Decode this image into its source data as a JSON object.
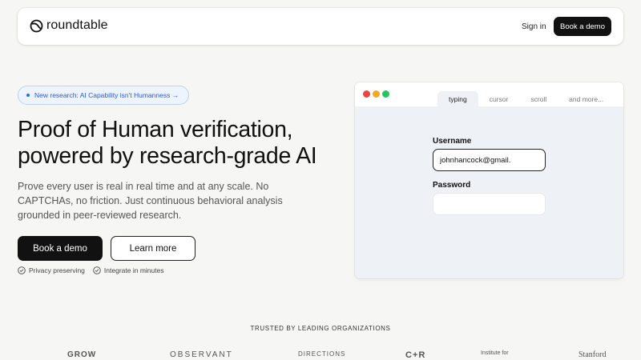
{
  "header": {
    "brand": "roundtable",
    "sign_in": "Sign in",
    "book_demo": "Book a demo"
  },
  "hero": {
    "pill": "New research: AI Capability isn't Humanness →",
    "title_line1": "Proof of Human verification,",
    "title_line2": "powered by research-grade AI",
    "subtitle": "Prove every user is real in real time and at any scale. No CAPTCHAs, no friction. Just continuous behavioral analysis grounded in peer-reviewed research.",
    "primary_button": "Book a demo",
    "secondary_button": "Learn more",
    "checks": [
      "Privacy preserving",
      "Integrate in minutes"
    ]
  },
  "demo": {
    "tabs": [
      "typing",
      "cursor",
      "scroll",
      "and more..."
    ],
    "active_tab": "typing",
    "username_label": "Username",
    "username_value": "johnhancock@gmail.",
    "password_label": "Password",
    "password_value": ""
  },
  "trusted": {
    "heading": "TRUSTED BY LEADING ORGANIZATIONS",
    "logos": [
      "GROW",
      "OBSERVANT",
      "DIRECTIONS",
      "C+R",
      "Institute for",
      "Stanford"
    ]
  },
  "colors": {
    "accent_blue": "#2a5bd7",
    "dark": "#111111",
    "traffic_red": "#ef4444",
    "traffic_yellow": "#f5a623",
    "traffic_green": "#22c55e"
  }
}
